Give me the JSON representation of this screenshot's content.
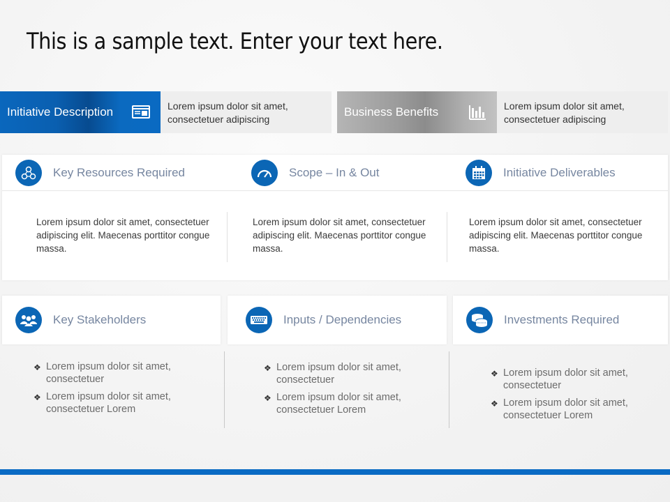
{
  "title": "This is a sample text. Enter your text here.",
  "tags": [
    {
      "label": "Initiative Description",
      "icon": "browser-window-icon",
      "description": "Lorem ipsum dolor sit amet, consectetuer adipiscing",
      "color": "#0a67bd"
    },
    {
      "label": "Business Benefits",
      "icon": "bar-chart-icon",
      "description": "Lorem ipsum dolor sit amet, consectetuer adipiscing",
      "color": "#9a9a9a"
    }
  ],
  "row1": [
    {
      "label": "Key Resources Required",
      "icon": "network-people-icon",
      "text": "Lorem ipsum dolor sit amet, consectetuer adipiscing elit. Maecenas porttitor congue massa."
    },
    {
      "label": "Scope – In & Out",
      "icon": "speedometer-icon",
      "text": "Lorem ipsum dolor sit amet, consectetuer adipiscing elit. Maecenas porttitor congue massa."
    },
    {
      "label": "Initiative Deliverables",
      "icon": "calendar-icon",
      "text": "Lorem ipsum dolor sit amet, consectetuer adipiscing elit. Maecenas porttitor congue massa."
    }
  ],
  "row2": [
    {
      "label": "Key Stakeholders",
      "icon": "group-people-icon",
      "bullets": [
        "Lorem ipsum dolor sit amet, consectetuer",
        "Lorem ipsum dolor sit amet, consectetuer Lorem"
      ]
    },
    {
      "label": "Inputs / Dependencies",
      "icon": "keyboard-icon",
      "bullets": [
        "Lorem ipsum dolor sit amet, consectetuer",
        "Lorem ipsum dolor sit amet, consectetuer Lorem"
      ]
    },
    {
      "label": "Investments Required",
      "icon": "coins-icon",
      "bullets": [
        "Lorem ipsum dolor sit amet, consectetuer",
        "Lorem ipsum dolor sit amet, consectetuer Lorem"
      ]
    }
  ],
  "bullet_glyph": "❖",
  "accent_color": "#0b66b5"
}
